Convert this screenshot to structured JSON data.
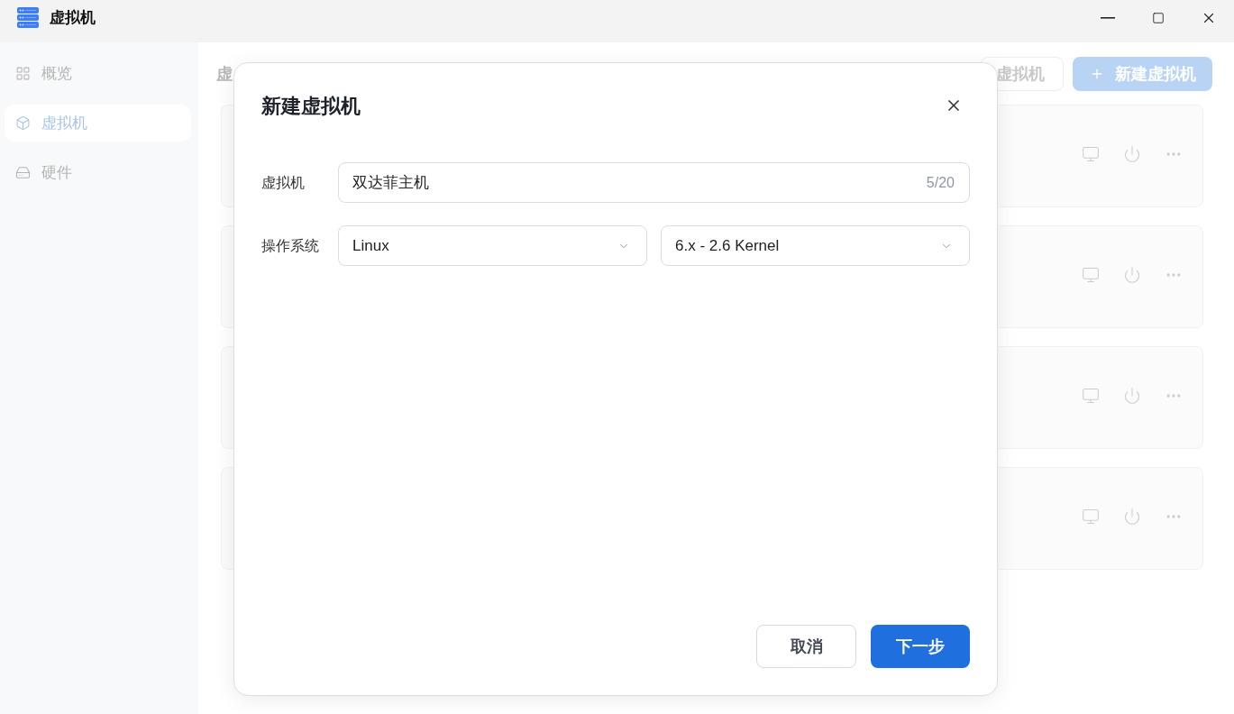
{
  "window": {
    "title": "虚拟机"
  },
  "sidebar": {
    "items": [
      {
        "label": "概览",
        "selected": false
      },
      {
        "label": "虚拟机",
        "selected": true
      },
      {
        "label": "硬件",
        "selected": false
      }
    ]
  },
  "main": {
    "heading": "虚",
    "toolbar_buttons": [
      {
        "label": "虚拟机",
        "kind": "outline"
      },
      {
        "label": "新建虚拟机",
        "kind": "primary"
      }
    ]
  },
  "dialog": {
    "title": "新建虚拟机",
    "fields": [
      {
        "kind": "text",
        "label": "虚拟机",
        "value": "双达菲主机",
        "counter": "5/20"
      },
      {
        "kind": "select_pair",
        "label": "操作系统",
        "selects": [
          {
            "value": "Linux"
          },
          {
            "value": "6.x - 2.6 Kernel"
          }
        ]
      }
    ],
    "buttons": [
      {
        "label": "取消",
        "kind": "secondary"
      },
      {
        "label": "下一步",
        "kind": "primary"
      }
    ]
  }
}
